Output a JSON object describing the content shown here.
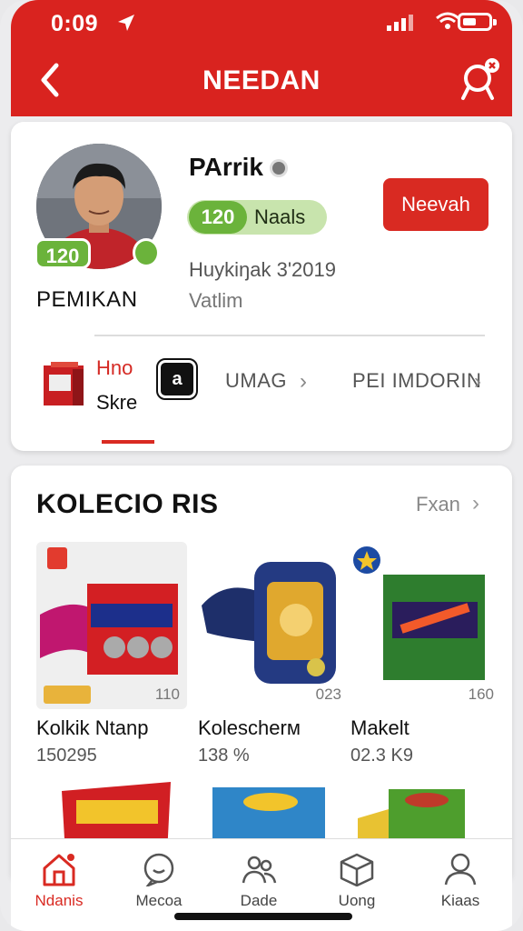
{
  "status": {
    "time": "0:09"
  },
  "header": {
    "title": "NEEDAN"
  },
  "profile": {
    "name": "PArrik",
    "level": "120",
    "rank": "PEMIKAN",
    "pill_number": "120",
    "pill_label": "Naals",
    "follow_label": "Neevah",
    "joined": "Huykiŋak 3'2019",
    "location": "Vatlim",
    "tabs": {
      "first_title": "Hno",
      "first_sub": "Skre",
      "badge": "a",
      "second": "UMAG",
      "third": "PEI IMDORIN"
    }
  },
  "collection": {
    "title": "KOLECIO RIS",
    "more": "Fxan",
    "products": [
      {
        "name": "Kolkik Ntanp",
        "price": "150295",
        "count": "110"
      },
      {
        "name": "Kolescherм",
        "price": "138 %",
        "count": "023"
      },
      {
        "name": "Makelt",
        "price": "02.3 K9",
        "count": "160"
      }
    ]
  },
  "nav": [
    {
      "label": "Ndanis",
      "icon": "home-icon"
    },
    {
      "label": "Mecoa",
      "icon": "chat-icon"
    },
    {
      "label": "Dade",
      "icon": "people-icon"
    },
    {
      "label": "Uong",
      "icon": "box-icon"
    },
    {
      "label": "Kiaas",
      "icon": "user-icon"
    }
  ],
  "colors": {
    "brand_red": "#d9231f",
    "accent_green": "#6bb33b"
  }
}
